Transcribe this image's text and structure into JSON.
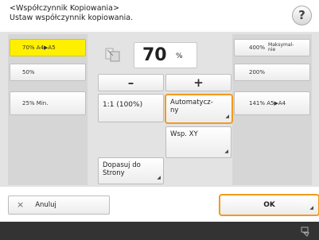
{
  "header": {
    "title": "<Współczynnik Kopiowania>",
    "subtitle": "Ustaw współczynnik kopiowania.",
    "help_label": "?"
  },
  "left_presets": [
    {
      "label": "70% A4▶A5",
      "selected": true
    },
    {
      "label": "50%",
      "selected": false
    },
    {
      "label": "25% Min.",
      "selected": false
    }
  ],
  "zoom": {
    "value": "70",
    "unit": "%"
  },
  "controls": {
    "minus": "–",
    "plus": "+",
    "one_to_one": "1:1 (100%)",
    "auto_line1": "Automatycz-",
    "auto_line2": "ny",
    "xy": "Wsp. XY",
    "fit_line1": "Dopasuj do",
    "fit_line2": "Strony"
  },
  "right_presets": [
    {
      "pct": "400%",
      "desc_line1": "Maksymal-",
      "desc_line2": "nie"
    },
    {
      "pct": "200%",
      "desc_line1": "",
      "desc_line2": ""
    },
    {
      "pct": "141% A5▶A4",
      "desc_line1": "",
      "desc_line2": ""
    }
  ],
  "footer": {
    "cancel_icon": "×",
    "cancel_label": "Anuluj",
    "ok_label": "OK"
  },
  "colors": {
    "selected": "#fff000",
    "highlight": "#f39a1f"
  },
  "icons": [
    "zoom-scale-icon",
    "corner-arrow-icon",
    "remote-operation-icon"
  ]
}
